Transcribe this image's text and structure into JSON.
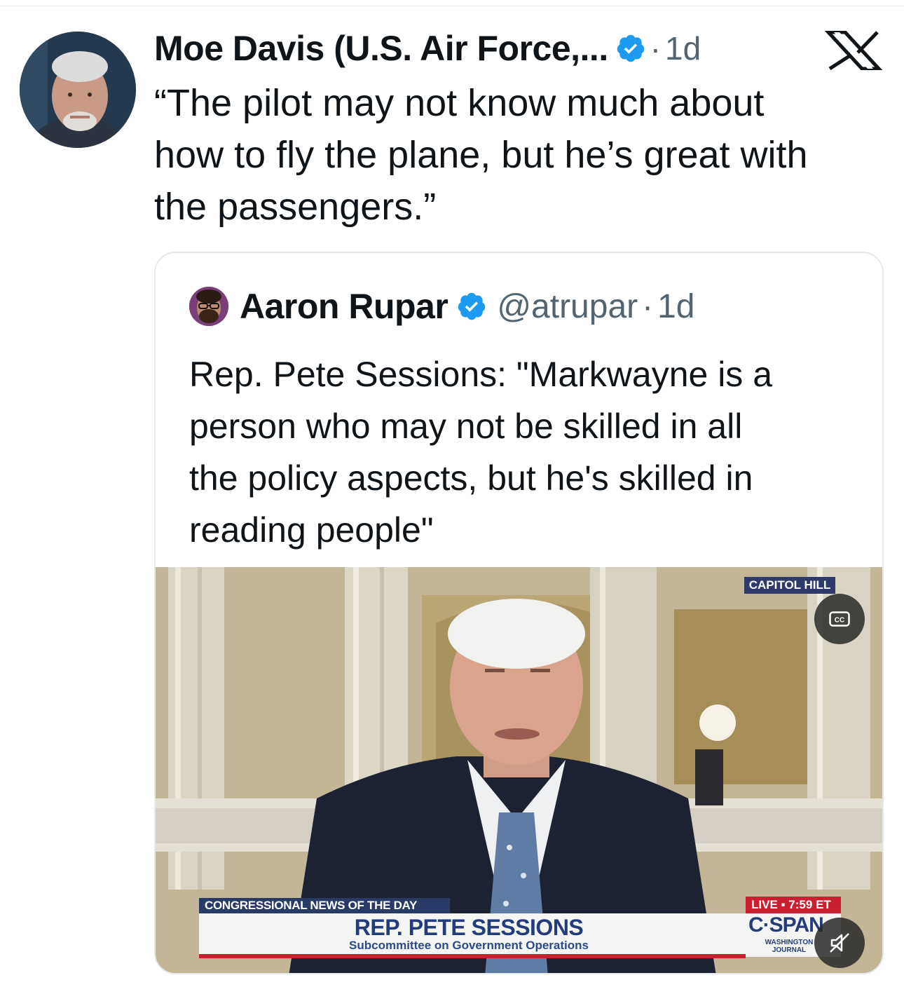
{
  "tweet": {
    "author_name": "Moe Davis (U.S. Air Force,...",
    "separator": "·",
    "time": "1d",
    "text": "“The pilot may not know much about\nhow to fly the plane, but he’s great with\nthe passengers.”"
  },
  "quote": {
    "author_name": "Aaron Rupar",
    "handle": "@atrupar",
    "separator": "·",
    "time": "1d",
    "text": "Rep. Pete Sessions: \"Markwayne is a\nperson who may not be skilled in all\nthe policy aspects, but he's skilled in\nreading people\""
  },
  "video": {
    "chyron_category": "CONGRESSIONAL NEWS OF THE DAY",
    "chyron_name": "REP. PETE SESSIONS",
    "chyron_subtitle": "Subcommittee on Government Operations",
    "location_tag": "CAPITOL HILL",
    "live_tag": "LIVE ▪ 7:59 ET",
    "network_logo": "C·SPAN",
    "program_logo": "WASHINGTON JOURNAL",
    "cc_label": "CC"
  },
  "colors": {
    "verified": "#1d9bf0",
    "secondary_text": "#536471",
    "border": "#e5eaec"
  },
  "icons": {
    "verified": "verified-badge-icon",
    "brand": "x-logo-icon",
    "captions": "closed-captions-icon",
    "mute": "muted-speaker-icon"
  }
}
